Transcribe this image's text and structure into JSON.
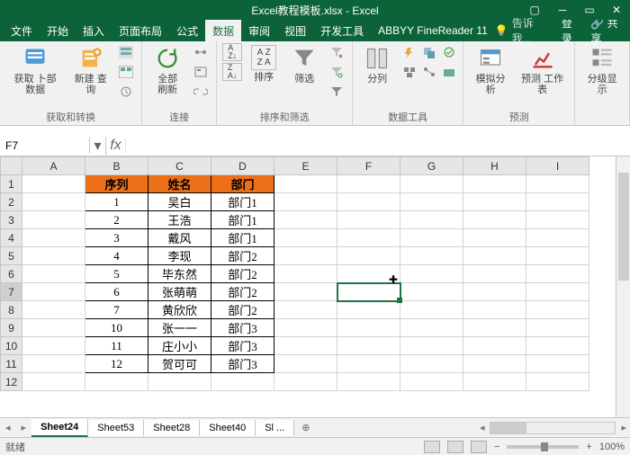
{
  "title": "Excel教程模板.xlsx - Excel",
  "tabs": {
    "file": "文件",
    "home": "开始",
    "insert": "插入",
    "layout": "页面布局",
    "formula": "公式",
    "data": "数据",
    "review": "审阅",
    "view": "视图",
    "dev": "开发工具",
    "abbyy": "ABBYY FineReader 11"
  },
  "tell_me": "告诉我...",
  "signin": "登录",
  "share": "共享",
  "ribbon": {
    "g1_btn1": "获取\n卜部数据",
    "g1_btn2": "新建\n查询",
    "g1_label": "获取和转换",
    "g2_btn": "全部刷新",
    "g2_label": "连接",
    "g3_btn": "排序",
    "g3_btn2": "筛选",
    "g3_label": "排序和筛选",
    "g4_btn": "分列",
    "g4_label": "数据工具",
    "g5_btn1": "模拟分析",
    "g5_btn2": "预测\n工作表",
    "g5_label": "预测",
    "g6_btn": "分级显示"
  },
  "namebox": {
    "ref": "F7",
    "fx": "fx"
  },
  "cols": [
    "A",
    "B",
    "C",
    "D",
    "E",
    "F",
    "G",
    "H",
    "I"
  ],
  "rows": [
    "1",
    "2",
    "3",
    "4",
    "5",
    "6",
    "7",
    "8",
    "9",
    "10",
    "11",
    "12"
  ],
  "headers": {
    "seq": "序列",
    "name": "姓名",
    "dept": "部门"
  },
  "data": [
    {
      "seq": "1",
      "name": "吴白",
      "dept": "部门1"
    },
    {
      "seq": "2",
      "name": "王浩",
      "dept": "部门1"
    },
    {
      "seq": "3",
      "name": "戴风",
      "dept": "部门1"
    },
    {
      "seq": "4",
      "name": "李现",
      "dept": "部门2"
    },
    {
      "seq": "5",
      "name": "毕东然",
      "dept": "部门2"
    },
    {
      "seq": "6",
      "name": "张萌萌",
      "dept": "部门2"
    },
    {
      "seq": "7",
      "name": "黄欣欣",
      "dept": "部门2"
    },
    {
      "seq": "10",
      "name": "张一一",
      "dept": "部门3"
    },
    {
      "seq": "11",
      "name": "庄小小",
      "dept": "部门3"
    },
    {
      "seq": "12",
      "name": "贺可可",
      "dept": "部门3"
    }
  ],
  "sheets": {
    "s1": "Sheet24",
    "s2": "Sheet53",
    "s3": "Sheet28",
    "s4": "Sheet40",
    "s5": "Sl ..."
  },
  "status": {
    "ready": "就绪",
    "zoom": "100%"
  }
}
